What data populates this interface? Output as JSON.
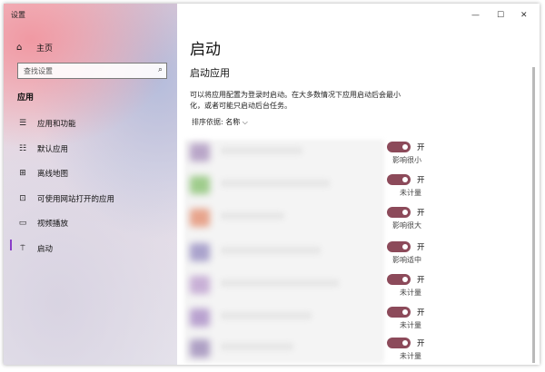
{
  "window": {
    "title": "设置"
  },
  "window_controls": {
    "minimize": "—",
    "maximize": "☐",
    "close": "✕"
  },
  "sidebar": {
    "home_label": "主页",
    "search_placeholder": "查找设置",
    "section_title": "应用",
    "items": [
      {
        "label": "应用和功能",
        "icon": "apps-list-icon"
      },
      {
        "label": "默认应用",
        "icon": "default-apps-icon"
      },
      {
        "label": "离线地图",
        "icon": "map-icon"
      },
      {
        "label": "可使用网站打开的应用",
        "icon": "website-icon"
      },
      {
        "label": "视频播放",
        "icon": "video-icon"
      },
      {
        "label": "启动",
        "icon": "startup-icon",
        "active": true
      }
    ]
  },
  "main": {
    "title": "启动",
    "subheading": "启动应用",
    "description": "可以将应用配置为登录时启动。在大多数情况下应用启动后会最小化，或者可能只启动后台任务。",
    "sort_label": "排序依据:",
    "sort_value": "名称",
    "apps": [
      {
        "state": "开",
        "impact": "影响很小",
        "on": true
      },
      {
        "state": "开",
        "impact": "未计量",
        "on": true
      },
      {
        "state": "开",
        "impact": "影响很大",
        "on": true
      },
      {
        "state": "开",
        "impact": "影响适中",
        "on": true
      },
      {
        "state": "开",
        "impact": "未计量",
        "on": true
      },
      {
        "state": "开",
        "impact": "未计量",
        "on": true
      },
      {
        "state": "开",
        "impact": "未计量",
        "on": true
      }
    ]
  },
  "colors": {
    "toggle_on": "#8c4a5a",
    "accent": "#8a3ec8"
  }
}
